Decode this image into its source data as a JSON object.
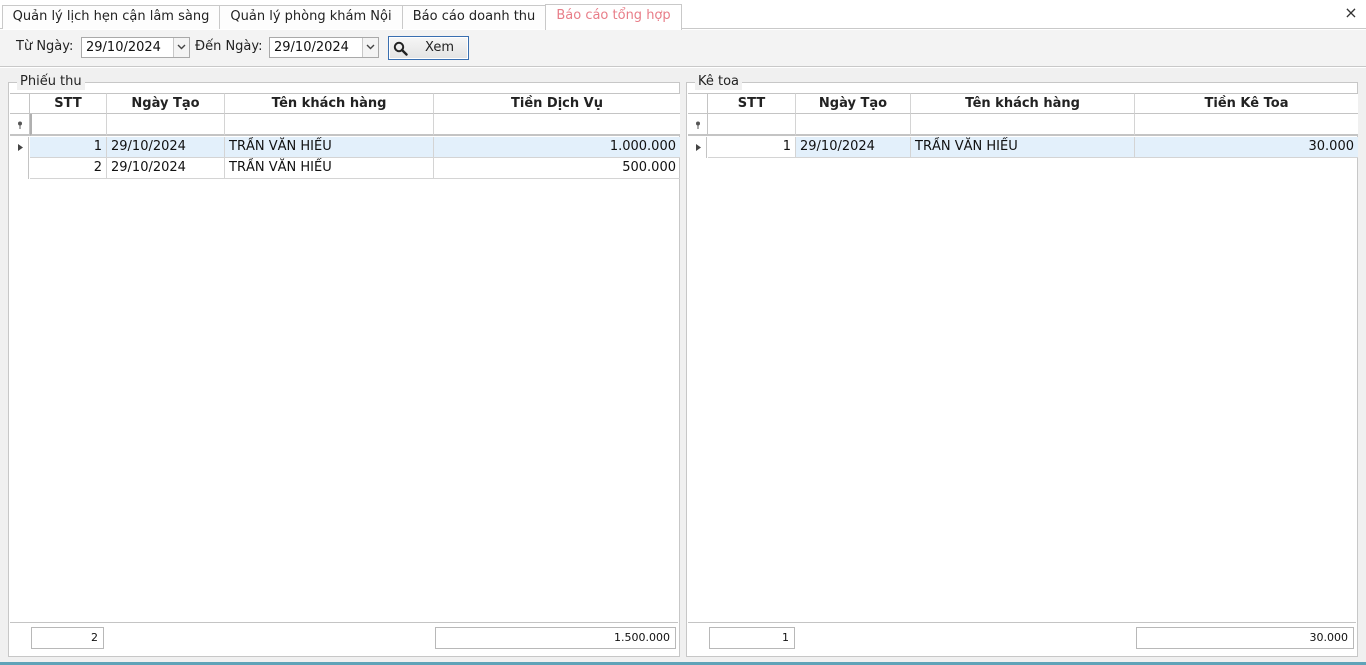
{
  "tabs": [
    {
      "label": "Quản lý lịch hẹn cận lâm sàng"
    },
    {
      "label": "Quản lý phòng khám Nội"
    },
    {
      "label": "Báo cáo doanh thu"
    },
    {
      "label": "Báo cáo tổng hợp"
    }
  ],
  "close_icon": "close-icon",
  "toolbar": {
    "from_label": "Từ Ngày:",
    "from_value": "29/10/2024",
    "to_label": "Đến Ngày:",
    "to_value": "29/10/2024",
    "view_label": "Xem",
    "view_icon": "search-icon"
  },
  "left_panel": {
    "title": "Phiếu thu",
    "columns": [
      "STT",
      "Ngày Tạo",
      "Tên khách hàng",
      "Tiền Dịch Vụ"
    ],
    "rows": [
      {
        "stt": "1",
        "date": "29/10/2024",
        "name": "TRẦN VĂN HIẾU",
        "amount": "1.000.000"
      },
      {
        "stt": "2",
        "date": "29/10/2024",
        "name": "TRẦN VĂN HIẾU",
        "amount": "500.000"
      }
    ],
    "count_total": "2",
    "amount_total": "1.500.000"
  },
  "right_panel": {
    "title": "Kê toa",
    "columns": [
      "STT",
      "Ngày Tạo",
      "Tên khách hàng",
      "Tiền Kê Toa"
    ],
    "rows": [
      {
        "stt": "1",
        "date": "29/10/2024",
        "name": "TRẦN VĂN HIẾU",
        "amount": "30.000"
      }
    ],
    "count_total": "1",
    "amount_total": "30.000"
  },
  "colors": {
    "active_tab_text": "#e87d88",
    "selected_row": "#e3f0fb",
    "button_border": "#3a6fb0"
  }
}
